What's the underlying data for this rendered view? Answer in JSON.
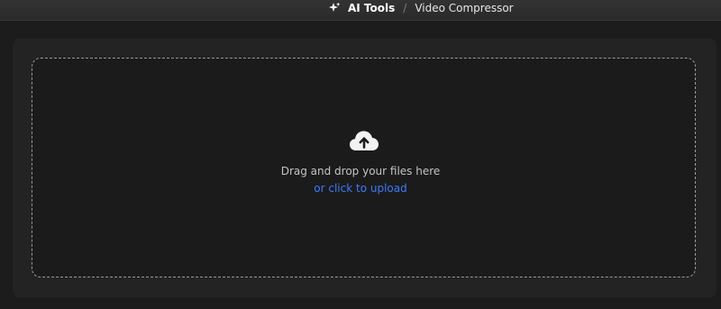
{
  "breadcrumb": {
    "root": "AI Tools",
    "separator": "/",
    "current": "Video Compressor"
  },
  "dropzone": {
    "instruction": "Drag and drop your files here",
    "upload_link": "or click to upload"
  },
  "icons": {
    "sparkle": "sparkle-icon",
    "upload": "cloud-upload-icon"
  },
  "colors": {
    "background": "#1c1c1c",
    "panel": "#232323",
    "link": "#3d7bff",
    "text_muted": "#c4c4c4"
  }
}
